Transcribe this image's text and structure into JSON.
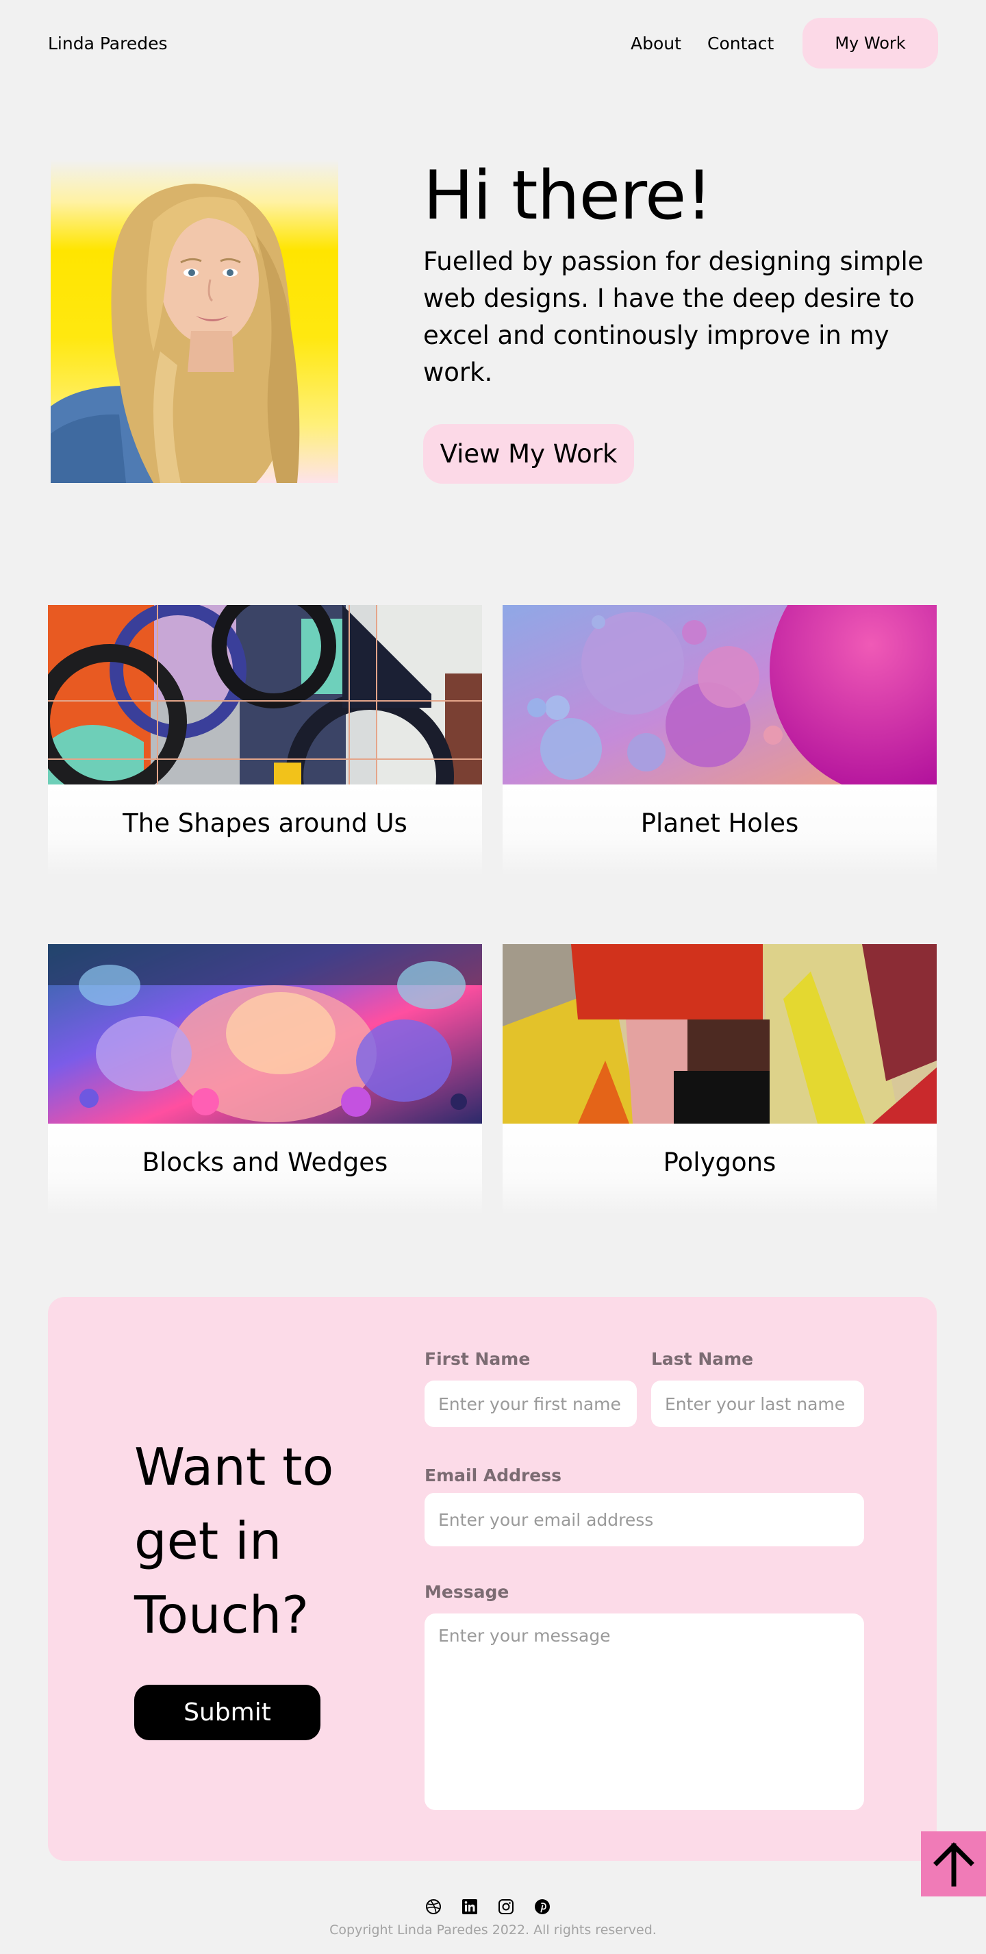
{
  "nav": {
    "brand": "Linda Paredes",
    "links": [
      "About",
      "Contact"
    ],
    "cta": "My Work"
  },
  "hero": {
    "title": "Hi there!",
    "text": "Fuelled by passion for designing simple web designs. I have the deep desire to excel and continously improve in my work.",
    "button": "View My Work"
  },
  "projects": [
    {
      "title": "The Shapes around Us"
    },
    {
      "title": "Planet Holes"
    },
    {
      "title": "Blocks and Wedges"
    },
    {
      "title": "Polygons"
    }
  ],
  "contact": {
    "title": "Want to get in Touch?",
    "submit": "Submit",
    "first_name": {
      "label": "First Name",
      "placeholder": "Enter your first name"
    },
    "last_name": {
      "label": "Last Name",
      "placeholder": "Enter your last name"
    },
    "email": {
      "label": "Email Address",
      "placeholder": "Enter your email address"
    },
    "message": {
      "label": "Message",
      "placeholder": "Enter your message"
    }
  },
  "footer": {
    "socials": [
      "dribbble-icon",
      "linkedin-icon",
      "instagram-icon",
      "pinterest-icon"
    ],
    "copyright": "Copyright Linda Paredes 2022. All rights reserved."
  },
  "colors": {
    "background": "#f1f1f1",
    "accent_pink": "#fcd9e7",
    "back_to_top": "#f07bb7",
    "submit": "#000000"
  }
}
